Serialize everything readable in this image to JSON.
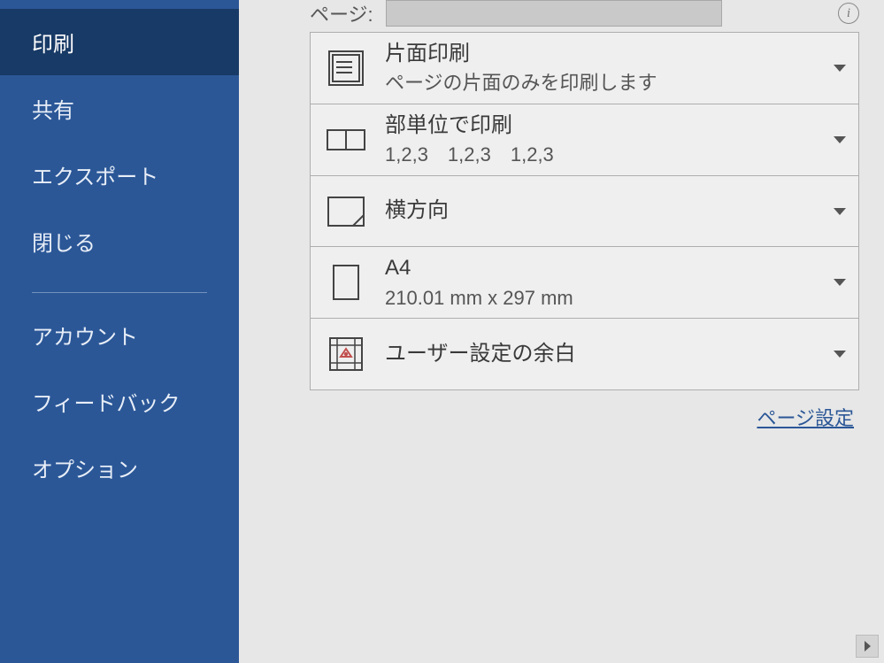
{
  "sidebar": {
    "items": [
      {
        "label": "印刷",
        "active": true
      },
      {
        "label": "共有"
      },
      {
        "label": "エクスポート"
      },
      {
        "label": "閉じる"
      }
    ],
    "footer": [
      {
        "label": "アカウント"
      },
      {
        "label": "フィードバック"
      },
      {
        "label": "オプション"
      }
    ]
  },
  "pages_row": {
    "label": "ページ:",
    "value": ""
  },
  "settings": {
    "sides": {
      "title": "片面印刷",
      "sub": "ページの片面のみを印刷します"
    },
    "collate": {
      "title": "部単位で印刷",
      "sub": "1,2,3　1,2,3　1,2,3"
    },
    "orientation": {
      "title": "横方向"
    },
    "paper": {
      "title": "A4",
      "sub": "210.01 mm x 297 mm"
    },
    "margins": {
      "title": "ユーザー設定の余白"
    }
  },
  "page_setup_link": "ページ設定"
}
